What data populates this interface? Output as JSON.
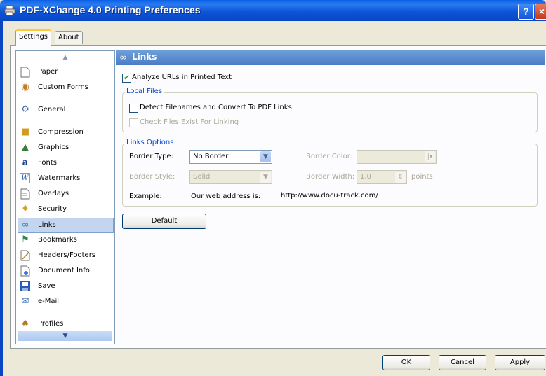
{
  "window": {
    "title": "PDF-XChange 4.0 Printing Preferences",
    "help_label": "?",
    "close_label": "×"
  },
  "tabs": [
    "Settings",
    "About"
  ],
  "sidebar": {
    "items": [
      {
        "label": "Paper",
        "icon": "paper-icon"
      },
      {
        "label": "Custom Forms",
        "icon": "custom-forms-icon"
      },
      {
        "label": "General",
        "icon": "general-icon"
      },
      {
        "label": "Compression",
        "icon": "compression-icon"
      },
      {
        "label": "Graphics",
        "icon": "graphics-icon"
      },
      {
        "label": "Fonts",
        "icon": "fonts-icon"
      },
      {
        "label": "Watermarks",
        "icon": "watermarks-icon"
      },
      {
        "label": "Overlays",
        "icon": "overlays-icon"
      },
      {
        "label": "Security",
        "icon": "security-icon"
      },
      {
        "label": "Links",
        "icon": "links-icon",
        "selected": true
      },
      {
        "label": "Bookmarks",
        "icon": "bookmarks-icon"
      },
      {
        "label": "Headers/Footers",
        "icon": "headers-footers-icon"
      },
      {
        "label": "Document Info",
        "icon": "document-info-icon"
      },
      {
        "label": "Save",
        "icon": "save-icon"
      },
      {
        "label": "e-Mail",
        "icon": "email-icon"
      },
      {
        "label": "Profiles",
        "icon": "profiles-icon"
      }
    ]
  },
  "content": {
    "title": "Links",
    "analyze_urls": {
      "label": "Analyze URLs in Printed Text",
      "checked": true
    },
    "local_files": {
      "title": "Local Files",
      "detect_filenames": {
        "label": "Detect Filenames and Convert To PDF Links",
        "checked": false
      },
      "check_files": {
        "label": "Check Files Exist For Linking",
        "checked": false,
        "disabled": true
      }
    },
    "links_options": {
      "title": "Links Options",
      "border_type_label": "Border Type:",
      "border_type_value": "No Border",
      "border_color_label": "Border Color:",
      "border_color_value": "",
      "border_style_label": "Border Style:",
      "border_style_value": "Solid",
      "border_width_label": "Border Width:",
      "border_width_value": "1.0",
      "border_width_unit": "points",
      "example_label": "Example:",
      "example_text": "Our web address is:",
      "example_url": "http://www.docu-track.com/"
    },
    "default_button": "Default"
  },
  "footer": {
    "ok": "OK",
    "cancel": "Cancel",
    "apply": "Apply"
  }
}
